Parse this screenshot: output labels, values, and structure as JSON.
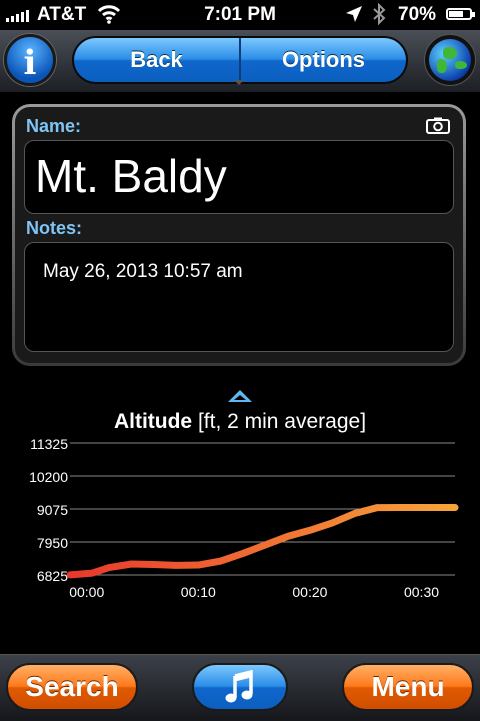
{
  "status_bar": {
    "carrier": "AT&T",
    "time": "7:01 PM",
    "battery": "70%",
    "battery_level": 0.7
  },
  "nav": {
    "back_label": "Back",
    "options_label": "Options",
    "info_glyph": "i"
  },
  "waypoint": {
    "name_label": "Name:",
    "name_value": "Mt. Baldy",
    "notes_label": "Notes:",
    "notes_value": "May 26, 2013 10:57 am"
  },
  "chart_title": {
    "main": "Altitude",
    "sub": " [ft, 2 min average]"
  },
  "chart_data": {
    "type": "line",
    "title": "Altitude [ft, 2 min average]",
    "xlabel": "",
    "ylabel": "",
    "x_ticks": [
      "00:00",
      "00:10",
      "00:20",
      "00:30"
    ],
    "y_ticks": [
      11325,
      10200,
      9075,
      7950,
      6825
    ],
    "xlim": [
      -1.5,
      33
    ],
    "ylim": [
      6825,
      11325
    ],
    "grid": true,
    "series": [
      {
        "x": [
          -1.5,
          0.5,
          2,
          4,
          6,
          8,
          10,
          12,
          14,
          16,
          18,
          20,
          22,
          24,
          26,
          28,
          30,
          32,
          33
        ],
        "y": [
          6830,
          6890,
          7080,
          7200,
          7185,
          7155,
          7165,
          7300,
          7560,
          7850,
          8140,
          8350,
          8600,
          8920,
          9120,
          9125,
          9125,
          9125,
          9125
        ]
      }
    ]
  },
  "toolbar": {
    "search_label": "Search",
    "menu_label": "Menu"
  },
  "colors": {
    "accent_blue": "#1a7fe0",
    "accent_orange": "#ff7a1c",
    "label_blue": "#7fc4f5",
    "line_start": "#e8382c",
    "line_end": "#f7a53a"
  }
}
